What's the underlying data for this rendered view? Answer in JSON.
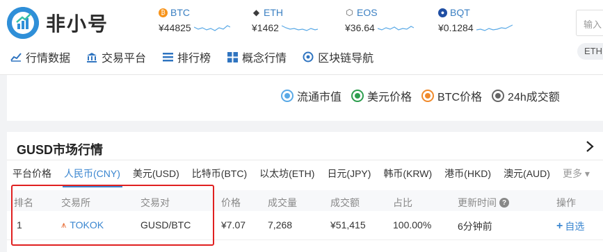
{
  "header": {
    "logo_text": "非小号",
    "tickers": [
      {
        "symbol": "BTC",
        "price": "¥44825",
        "icon": "bitcoin-icon",
        "icon_color": "#f7931a",
        "glyph": "₿"
      },
      {
        "symbol": "ETH",
        "price": "¥1462",
        "icon": "ethereum-icon",
        "icon_color": "#3c3c3d",
        "glyph": "◆"
      },
      {
        "symbol": "EOS",
        "price": "¥36.64",
        "icon": "eos-icon",
        "icon_color": "#555555",
        "glyph": "⬡"
      },
      {
        "symbol": "BQT",
        "price": "¥0.1284",
        "icon": "bqt-icon",
        "icon_color": "#1f4ea3",
        "glyph": "●"
      }
    ],
    "search_placeholder": "输入",
    "chip_label": "ETH"
  },
  "nav": [
    {
      "label": "行情数据",
      "icon": "chart-line-icon"
    },
    {
      "label": "交易平台",
      "icon": "bank-icon"
    },
    {
      "label": "排行榜",
      "icon": "list-icon"
    },
    {
      "label": "概念行情",
      "icon": "grid-icon"
    },
    {
      "label": "区块链导航",
      "icon": "compass-icon"
    }
  ],
  "legend": [
    {
      "label": "流通市值",
      "color": "#5aa9e6"
    },
    {
      "label": "美元价格",
      "color": "#2e9e4f"
    },
    {
      "label": "BTC价格",
      "color": "#f08a2c"
    },
    {
      "label": "24h成交额",
      "color": "#666666"
    }
  ],
  "market": {
    "title": "GUSD市场行情",
    "tabs": [
      "平台价格",
      "人民币(CNY)",
      "美元(USD)",
      "比特币(BTC)",
      "以太坊(ETH)",
      "日元(JPY)",
      "韩币(KRW)",
      "港币(HKD)",
      "澳元(AUD)",
      "更多"
    ],
    "active_tab": "人民币(CNY)",
    "columns": [
      "排名",
      "交易所",
      "交易对",
      "价格",
      "成交量",
      "成交额",
      "占比",
      "更新时间",
      "操作"
    ],
    "rows": [
      {
        "rank": "1",
        "exchange": "TOKOK",
        "pair": "GUSD/BTC",
        "price": "¥7.07",
        "volume": "7,268",
        "amount": "¥51,415",
        "share": "100.00%",
        "updated": "6分钟前",
        "action": "自选"
      }
    ]
  }
}
